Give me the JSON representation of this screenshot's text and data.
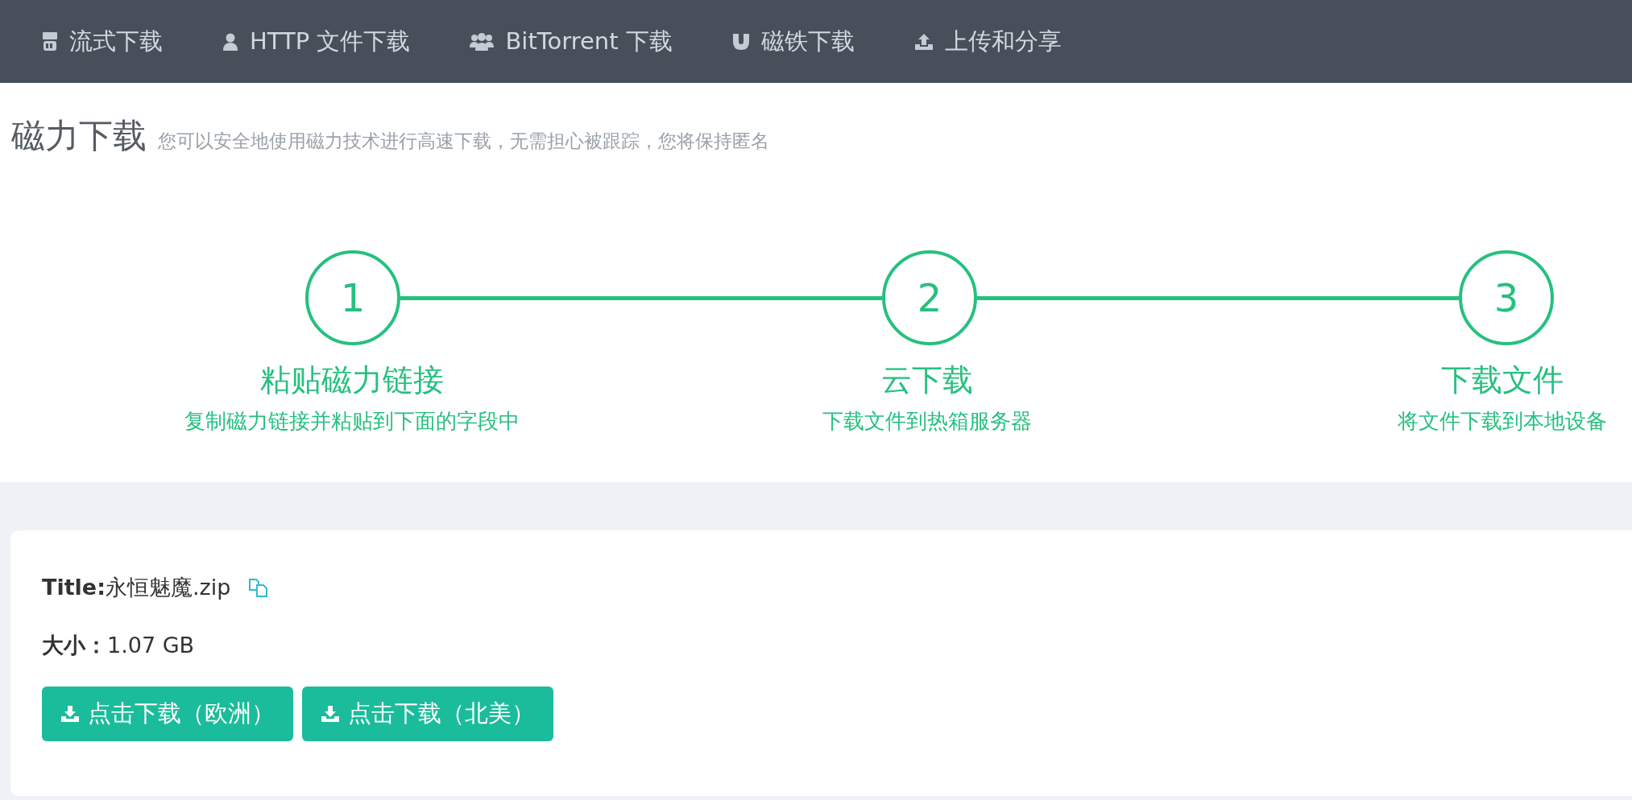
{
  "nav": [
    {
      "kind": "youtube",
      "label": "流式下载"
    },
    {
      "kind": "user",
      "label": "HTTP 文件下载"
    },
    {
      "kind": "users",
      "label": "BitTorrent 下载"
    },
    {
      "kind": "magnet",
      "label": "磁铁下载"
    },
    {
      "kind": "upload",
      "label": "上传和分享"
    }
  ],
  "heading": {
    "title": "磁力下载",
    "subtitle": "您可以安全地使用磁力技术进行高速下载，无需担心被跟踪，您将保持匿名"
  },
  "steps": [
    {
      "number": "1",
      "title": "粘贴磁力链接",
      "description": "复制磁力链接并粘贴到下面的字段中"
    },
    {
      "number": "2",
      "title": "云下载",
      "description": "下载文件到热箱服务器"
    },
    {
      "number": "3",
      "title": "下载文件",
      "description": "将文件下载到本地设备"
    }
  ],
  "file": {
    "title_label": "Title:",
    "title": "永恒魅魔.zip",
    "size_label": "大小：",
    "size": "1.07 GB"
  },
  "buttons": [
    {
      "label": "点击下载（欧洲）"
    },
    {
      "label": "点击下载（北美）"
    }
  ]
}
